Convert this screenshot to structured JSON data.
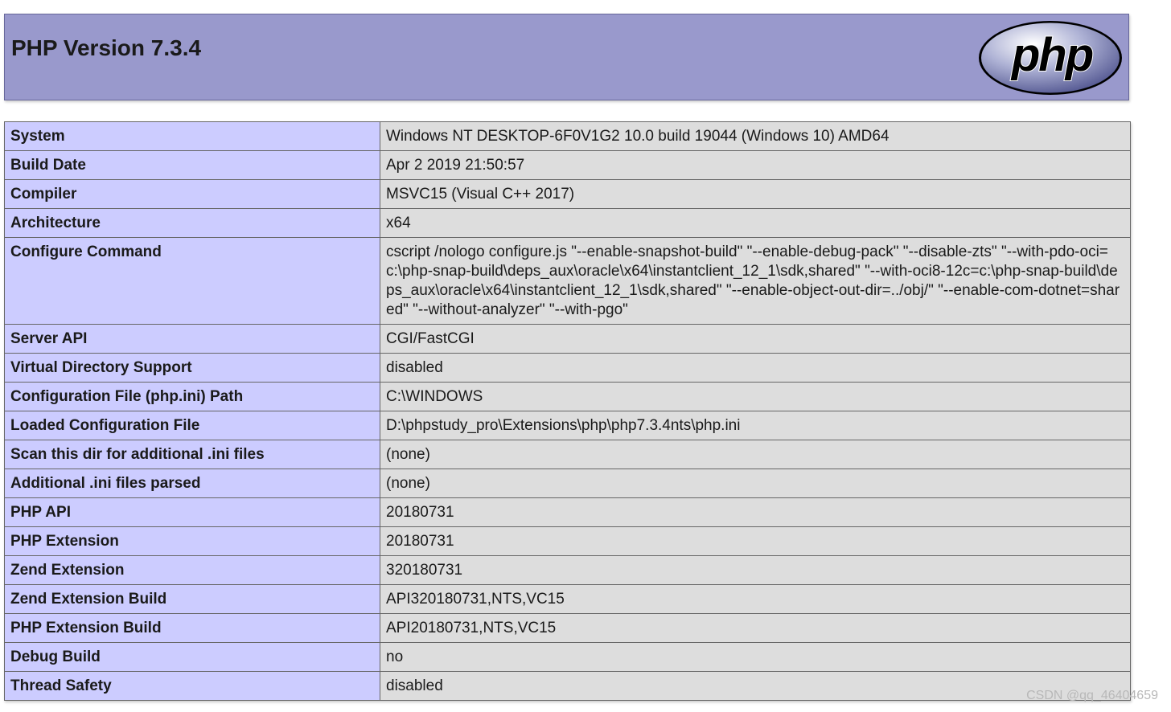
{
  "header": {
    "title": "PHP Version 7.3.4",
    "logo_text": "php",
    "bg_color": "#9999cc"
  },
  "rows": [
    {
      "key": "System",
      "value": "Windows NT DESKTOP-6F0V1G2 10.0 build 19044 (Windows 10) AMD64"
    },
    {
      "key": "Build Date",
      "value": "Apr 2 2019 21:50:57"
    },
    {
      "key": "Compiler",
      "value": "MSVC15 (Visual C++ 2017)"
    },
    {
      "key": "Architecture",
      "value": "x64"
    },
    {
      "key": "Configure Command",
      "value": "cscript /nologo configure.js \"--enable-snapshot-build\" \"--enable-debug-pack\" \"--disable-zts\" \"--with-pdo-oci=c:\\php-snap-build\\deps_aux\\oracle\\x64\\instantclient_12_1\\sdk,shared\" \"--with-oci8-12c=c:\\php-snap-build\\deps_aux\\oracle\\x64\\instantclient_12_1\\sdk,shared\" \"--enable-object-out-dir=../obj/\" \"--enable-com-dotnet=shared\" \"--without-analyzer\" \"--with-pgo\""
    },
    {
      "key": "Server API",
      "value": "CGI/FastCGI"
    },
    {
      "key": "Virtual Directory Support",
      "value": "disabled"
    },
    {
      "key": "Configuration File (php.ini) Path",
      "value": "C:\\WINDOWS"
    },
    {
      "key": "Loaded Configuration File",
      "value": "D:\\phpstudy_pro\\Extensions\\php\\php7.3.4nts\\php.ini"
    },
    {
      "key": "Scan this dir for additional .ini files",
      "value": "(none)"
    },
    {
      "key": "Additional .ini files parsed",
      "value": "(none)"
    },
    {
      "key": "PHP API",
      "value": "20180731"
    },
    {
      "key": "PHP Extension",
      "value": "20180731"
    },
    {
      "key": "Zend Extension",
      "value": "320180731"
    },
    {
      "key": "Zend Extension Build",
      "value": "API320180731,NTS,VC15"
    },
    {
      "key": "PHP Extension Build",
      "value": "API20180731,NTS,VC15"
    },
    {
      "key": "Debug Build",
      "value": "no"
    },
    {
      "key": "Thread Safety",
      "value": "disabled"
    }
  ],
  "colors": {
    "key_cell": "#ccccff",
    "value_cell": "#dddddd",
    "border": "#666666"
  },
  "watermark": "CSDN @qq_46404659"
}
